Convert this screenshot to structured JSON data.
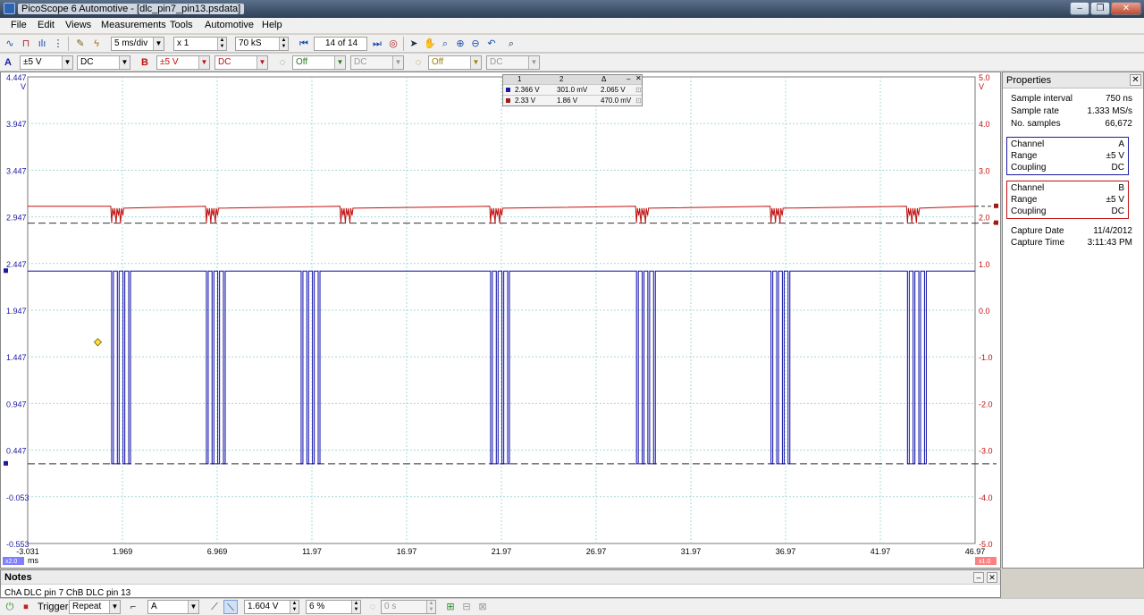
{
  "window": {
    "title": "PicoScope 6 Automotive - [dlc_pin7_pin13.psdata]"
  },
  "menu": [
    "File",
    "Edit",
    "Views",
    "Measurements",
    "Tools",
    "Automotive",
    "Help"
  ],
  "toolbar1": {
    "timebase": "5 ms/div",
    "zoom": "x 1",
    "samples": "70 kS",
    "buffer": "14 of 14"
  },
  "toolbar2": {
    "chA_label": "A",
    "chA_range": "±5 V",
    "chA_coupling": "DC",
    "chB_label": "B",
    "chB_range": "±5 V",
    "chB_coupling": "DC",
    "chC_range": "Off",
    "chC_coupling": "DC",
    "chD_range": "Off",
    "chD_coupling": "DC"
  },
  "measurements": {
    "headers": [
      "1",
      "2",
      "Δ"
    ],
    "rows": [
      {
        "v1": "2.366 V",
        "v2": "301.0 mV",
        "delta": "2.065 V",
        "color": "#1a1aa0"
      },
      {
        "v1": "2.33 V",
        "v2": "1.86 V",
        "delta": "470.0 mV",
        "color": "#a01a1a"
      }
    ]
  },
  "scope": {
    "left_axis_ticks": [
      "4.447",
      "3.947",
      "3.447",
      "2.947",
      "2.447",
      "1.947",
      "1.447",
      "0.947",
      "0.447",
      "-0.053",
      "-0.553"
    ],
    "left_unit": "V",
    "right_axis_ticks": [
      "5.0",
      "4.0",
      "3.0",
      "2.0",
      "1.0",
      "0.0",
      "-1.0",
      "-2.0",
      "-3.0",
      "-4.0",
      "-5.0"
    ],
    "right_unit": "V",
    "x_ticks": [
      "-3.031",
      "1.969",
      "6.969",
      "11.97",
      "16.97",
      "21.97",
      "26.97",
      "31.97",
      "36.97",
      "41.97",
      "46.97"
    ],
    "x_unit": "ms",
    "left_zoom": "x2.0",
    "right_zoom": "x1.0",
    "chA_color": "#0a0aa8",
    "chB_color": "#c01010",
    "chA_bursts": [
      1.4,
      6.4,
      11.4,
      21.4,
      29.1,
      36.2,
      43.4
    ],
    "chB_bursts": [
      1.4,
      6.4,
      13.5,
      21.4,
      29.1,
      36.2,
      43.4
    ]
  },
  "properties": {
    "title": "Properties",
    "sample_interval_label": "Sample interval",
    "sample_interval": "750 ns",
    "sample_rate_label": "Sample rate",
    "sample_rate": "1.333 MS/s",
    "no_samples_label": "No. samples",
    "no_samples": "66,672",
    "chA": {
      "channel_label": "Channel",
      "channel": "A",
      "range_label": "Range",
      "range": "±5 V",
      "coupling_label": "Coupling",
      "coupling": "DC"
    },
    "chB": {
      "channel_label": "Channel",
      "channel": "B",
      "range_label": "Range",
      "range": "±5 V",
      "coupling_label": "Coupling",
      "coupling": "DC"
    },
    "capture_date_label": "Capture Date",
    "capture_date": "11/4/2012",
    "capture_time_label": "Capture Time",
    "capture_time": "3:11:43 PM"
  },
  "notes": {
    "title": "Notes",
    "text": "ChA DLC pin 7 ChB DLC pin 13"
  },
  "trigger": {
    "label": "Trigger",
    "mode": "Repeat",
    "source": "A",
    "threshold": "1.604 V",
    "pre_trigger": "6 %",
    "delay": "0 s"
  }
}
